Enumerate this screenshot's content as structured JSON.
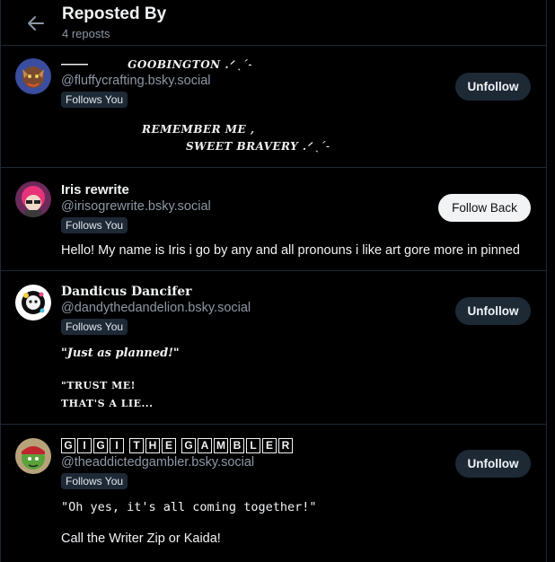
{
  "header": {
    "title": "Reposted By",
    "subtitle": "4 reposts"
  },
  "users": [
    {
      "name_prefix": "——",
      "name": "GOOBINGTON .ᐟ ˎˊ˗",
      "handle": "@fluffycrafting.bsky.social",
      "badge": "Follows You",
      "button": "Unfollow",
      "bio_line1": "REMEMBER ME ,",
      "bio_line2": "SWEET BRAVERY .ᐟ ˎˊ˗"
    },
    {
      "name": "Iris rewrite",
      "handle": "@irisogrewrite.bsky.social",
      "badge": "Follows You",
      "button": "Follow Back",
      "bio_line1": "Hello! My name is Iris i go by any and all pronouns i like art gore more in pinned"
    },
    {
      "name": "Dandicus Dancifer",
      "handle": "@dandythedandelion.bsky.social",
      "badge": "Follows You",
      "button": "Unfollow",
      "bio_line1": "\"Just as planned!\"",
      "bio_line2": "\"TRUST ME!",
      "bio_line3": "THAT'S A LIE..."
    },
    {
      "name": "GIGI THE GAMBLER",
      "handle": "@theaddictedgambler.bsky.social",
      "badge": "Follows You",
      "button": "Unfollow",
      "bio_line1": "\"Oh yes, it's all coming together!\"",
      "bio_line2": "Call the Writer Zip or Kaida!"
    }
  ],
  "colors": {
    "background": "#000000",
    "border": "#1e2936",
    "secondary_text": "#8d98a6",
    "button_dark": "#1e2936",
    "button_light": "#f1f3f5"
  }
}
